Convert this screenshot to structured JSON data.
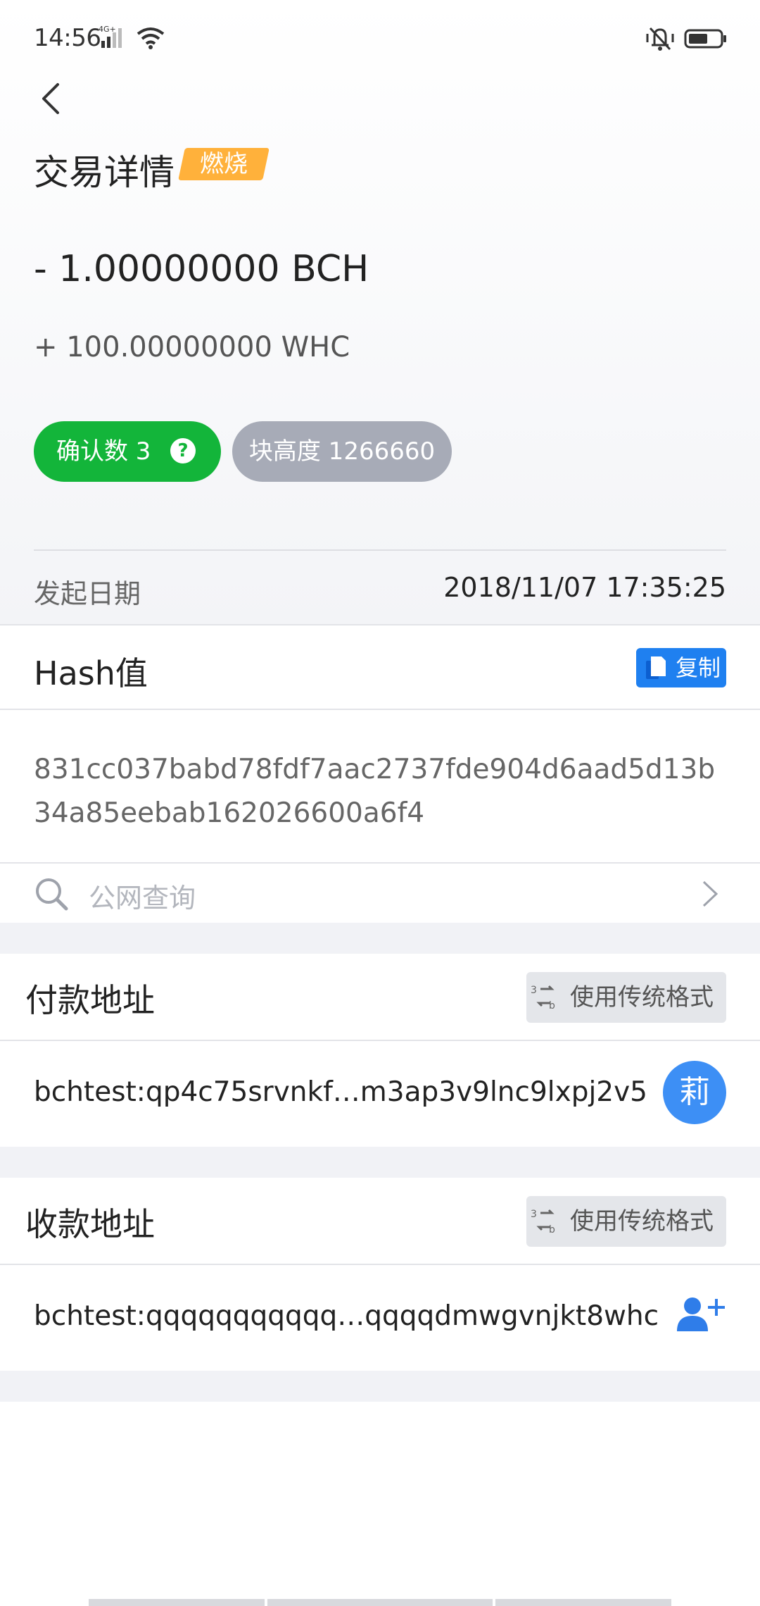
{
  "status_bar": {
    "time": "14:56",
    "network": "4G+",
    "icons": [
      "signal-icon",
      "wifi-icon",
      "vibrate-icon",
      "battery-icon"
    ]
  },
  "header": {
    "title": "交易详情",
    "badge": "燃烧"
  },
  "amounts": {
    "main": "- 1.00000000 BCH",
    "sub": "+ 100.00000000 WHC"
  },
  "status_pills": {
    "confirmations": "确认数 3",
    "block_height": "块高度 1266660"
  },
  "date": {
    "label": "发起日期",
    "value": "2018/11/07 17:35:25"
  },
  "hash": {
    "title": "Hash值",
    "copy_label": "复制",
    "value": "831cc037babd78fdf7aac2737fde904d6aad5d13b34a85eebab162026600a6f4"
  },
  "search": {
    "placeholder": "公网查询"
  },
  "payer": {
    "title": "付款地址",
    "format_button": "使用传统格式",
    "address": "bchtest:qp4c75srvnkf…m3ap3v9lnc9lxpj2v5",
    "avatar_char": "莉"
  },
  "payee": {
    "title": "收款地址",
    "format_button": "使用传统格式",
    "address": "bchtest:qqqqqqqqqqq…qqqqdmwgvnjkt8whc"
  },
  "colors": {
    "confirm_green": "#13b53a",
    "block_grey": "#a7abb7",
    "burn_orange": "#ffb13b",
    "primary_blue": "#1f80f0",
    "avatar_blue": "#3d8ff5"
  }
}
